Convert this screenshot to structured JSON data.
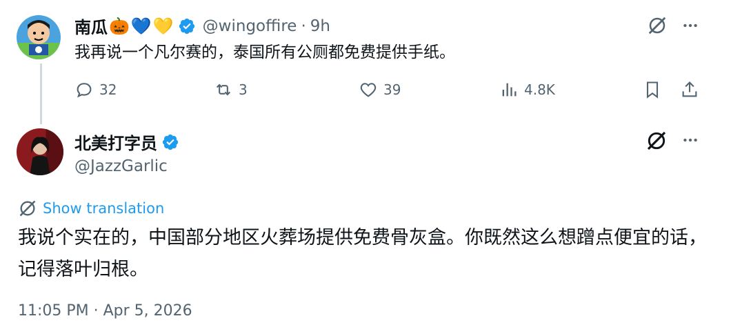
{
  "parent_tweet": {
    "display_name": "南瓜",
    "emojis": [
      "🎃",
      "💙",
      "💛"
    ],
    "handle": "@wingoffire",
    "separator": "·",
    "time_ago": "9h",
    "text": "我再说一个凡尔赛的，泰国所有公厕都免费提供手纸。",
    "actions": {
      "replies": "32",
      "reposts": "3",
      "likes": "39",
      "views": "4.8K"
    }
  },
  "main_tweet": {
    "display_name": "北美打字员",
    "handle": "@JazzGarlic",
    "show_translation": "Show translation",
    "text": "我说个实在的，中国部分地区火葬场提供免费骨灰盒。你既然这么想蹭点便宜的话，记得落叶归根。",
    "timestamp": "11:05 PM · Apr 5, 2026"
  },
  "colors": {
    "verified": "#1d9bf0",
    "link": "#1d9bf0",
    "secondary_text": "#536471",
    "primary_text": "#0f1419"
  },
  "icons": [
    "grok-icon",
    "more-icon",
    "reply-icon",
    "repost-icon",
    "like-icon",
    "views-icon",
    "bookmark-icon",
    "share-icon",
    "verified-badge-icon",
    "translate-icon"
  ]
}
